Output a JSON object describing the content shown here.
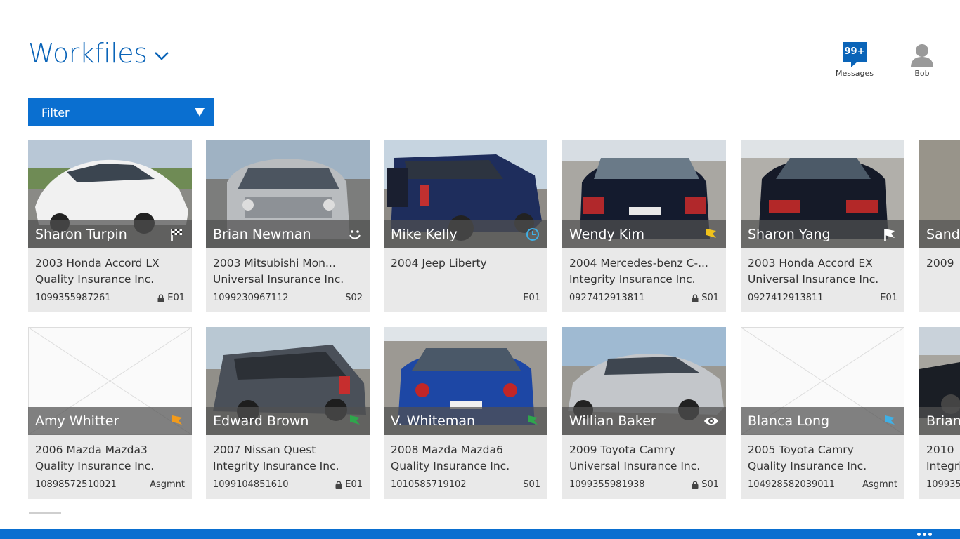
{
  "header": {
    "title": "Workfiles"
  },
  "messages": {
    "badge": "99+",
    "label": "Messages"
  },
  "user": {
    "name": "Bob"
  },
  "filter": {
    "label": "Filter"
  },
  "colors": {
    "accent": "#0a6fd0",
    "title": "#0a64b8"
  },
  "cards": [
    {
      "name": "Sharon Turpin",
      "vehicle": "2003 Honda Accord LX",
      "insurer": "Quality Insurance Inc.",
      "claim": "1099355987261",
      "code": "E01",
      "locked": true,
      "status_icon": "checkered-flag-icon",
      "photo": "white-sedan"
    },
    {
      "name": "Brian Newman",
      "vehicle": "2003 Mitsubishi Mon...",
      "insurer": "Universal Insurance Inc.",
      "claim": "1099230967112",
      "code": "S02",
      "locked": false,
      "status_icon": "smiley-icon",
      "photo": "silver-suv"
    },
    {
      "name": "Mike Kelly",
      "vehicle": "2004 Jeep Liberty",
      "insurer": "",
      "claim": "",
      "code": "E01",
      "locked": false,
      "status_icon": "clock-icon",
      "photo": "blue-jeep"
    },
    {
      "name": "Wendy Kim",
      "vehicle": "2004 Mercedes-benz C-...",
      "insurer": "Integrity Insurance Inc.",
      "claim": "0927412913811",
      "code": "S01",
      "locked": true,
      "status_icon": "yellow-flag-icon",
      "photo": "navy-sedan-rear"
    },
    {
      "name": "Sharon Yang",
      "vehicle": "2003 Honda Accord EX",
      "insurer": "Universal Insurance Inc.",
      "claim": "0927412913811",
      "code": "E01",
      "locked": false,
      "status_icon": "white-flag-icon",
      "photo": "black-sedan-rear"
    },
    {
      "name": "Sandy",
      "vehicle": "2009",
      "insurer": "",
      "claim": "",
      "code": "",
      "locked": false,
      "status_icon": "",
      "photo": "leather"
    },
    {
      "name": "Amy Whitter",
      "vehicle": "2006 Mazda Mazda3",
      "insurer": "Quality Insurance Inc.",
      "claim": "10898572510021",
      "code": "Asgmnt",
      "locked": false,
      "status_icon": "orange-flag-icon",
      "photo": "none"
    },
    {
      "name": "Edward Brown",
      "vehicle": "2007 Nissan Quest",
      "insurer": "Integrity Insurance Inc.",
      "claim": "1099104851610",
      "code": "E01",
      "locked": true,
      "status_icon": "green-flag-icon",
      "photo": "grey-van"
    },
    {
      "name": "V. Whiteman",
      "vehicle": "2008 Mazda Mazda6",
      "insurer": "Quality Insurance Inc.",
      "claim": "1010585719102",
      "code": "S01",
      "locked": false,
      "status_icon": "green-flag-icon",
      "photo": "blue-sedan-rear"
    },
    {
      "name": "Willian Baker",
      "vehicle": "2009 Toyota Camry",
      "insurer": "Universal Insurance Inc.",
      "claim": "1099355981938",
      "code": "S01",
      "locked": true,
      "status_icon": "eye-icon",
      "photo": "silver-sedan"
    },
    {
      "name": "Blanca Long",
      "vehicle": "2005 Toyota Camry",
      "insurer": "Quality Insurance Inc.",
      "claim": "104928582039011",
      "code": "Asgmnt",
      "locked": false,
      "status_icon": "blue-flag-icon",
      "photo": "none"
    },
    {
      "name": "Brian",
      "vehicle": "2010",
      "insurer": "Integri",
      "claim": "109935",
      "code": "",
      "locked": false,
      "status_icon": "",
      "photo": "dark-car"
    }
  ]
}
